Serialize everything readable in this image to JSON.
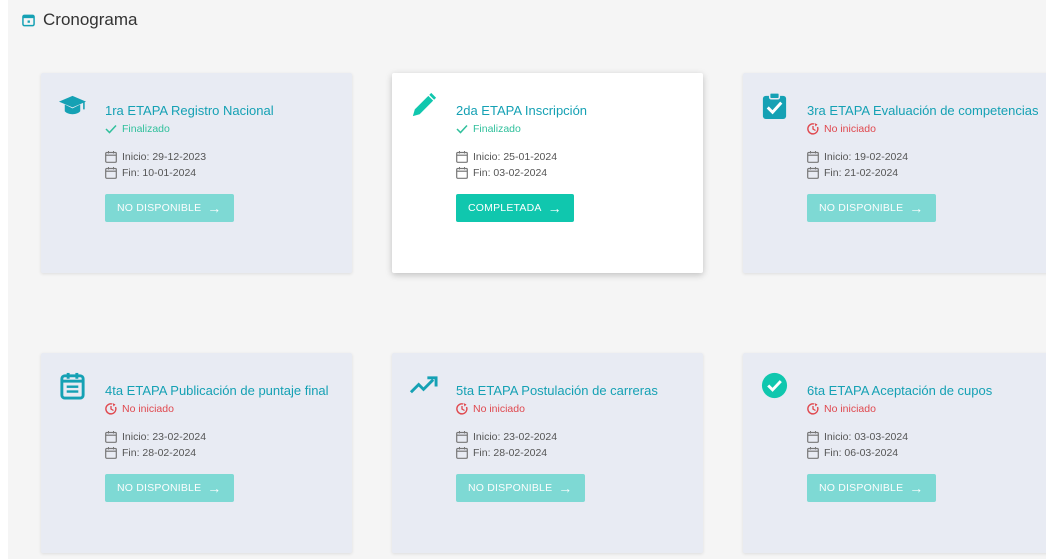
{
  "header": {
    "title": "Cronograma",
    "icon": "calendar-icon"
  },
  "labels": {
    "start_prefix": "Inicio: ",
    "end_prefix": "Fin: "
  },
  "colors": {
    "accent": "#15a1b4",
    "done": "#30c09c",
    "pending": "#e0484e",
    "button_enabled": "#10c7ae",
    "button_disabled": "#73d8d1"
  },
  "stages": [
    {
      "title": "1ra ETAPA Registro Nacional",
      "status": "Finalizado",
      "status_type": "done",
      "start": "Inicio: 29-12-2023",
      "end": "Fin: 10-01-2024",
      "button": "NO DISPONIBLE",
      "icon": "graduation-cap-icon",
      "active": false
    },
    {
      "title": "2da ETAPA Inscripción",
      "status": "Finalizado",
      "status_type": "done",
      "start": "Inicio: 25-01-2024",
      "end": "Fin: 03-02-2024",
      "button": "COMPLETADA",
      "icon": "pencil-icon",
      "active": true
    },
    {
      "title": "3ra ETAPA Evaluación de competencias",
      "status": "No iniciado",
      "status_type": "pending",
      "start": "Inicio: 19-02-2024",
      "end": "Fin: 21-02-2024",
      "button": "NO DISPONIBLE",
      "icon": "clipboard-check-icon",
      "active": false
    },
    {
      "title": "4ta ETAPA Publicación de puntaje final",
      "status": "No iniciado",
      "status_type": "pending",
      "start": "Inicio: 23-02-2024",
      "end": "Fin: 28-02-2024",
      "button": "NO DISPONIBLE",
      "icon": "list-calendar-icon",
      "active": false
    },
    {
      "title": "5ta ETAPA Postulación de carreras",
      "status": "No iniciado",
      "status_type": "pending",
      "start": "Inicio: 23-02-2024",
      "end": "Fin: 28-02-2024",
      "button": "NO DISPONIBLE",
      "icon": "trending-up-icon",
      "active": false
    },
    {
      "title": "6ta ETAPA Aceptación de cupos",
      "status": "No iniciado",
      "status_type": "pending",
      "start": "Inicio: 03-03-2024",
      "end": "Fin: 06-03-2024",
      "button": "NO DISPONIBLE",
      "icon": "check-circle-icon",
      "active": false
    }
  ]
}
